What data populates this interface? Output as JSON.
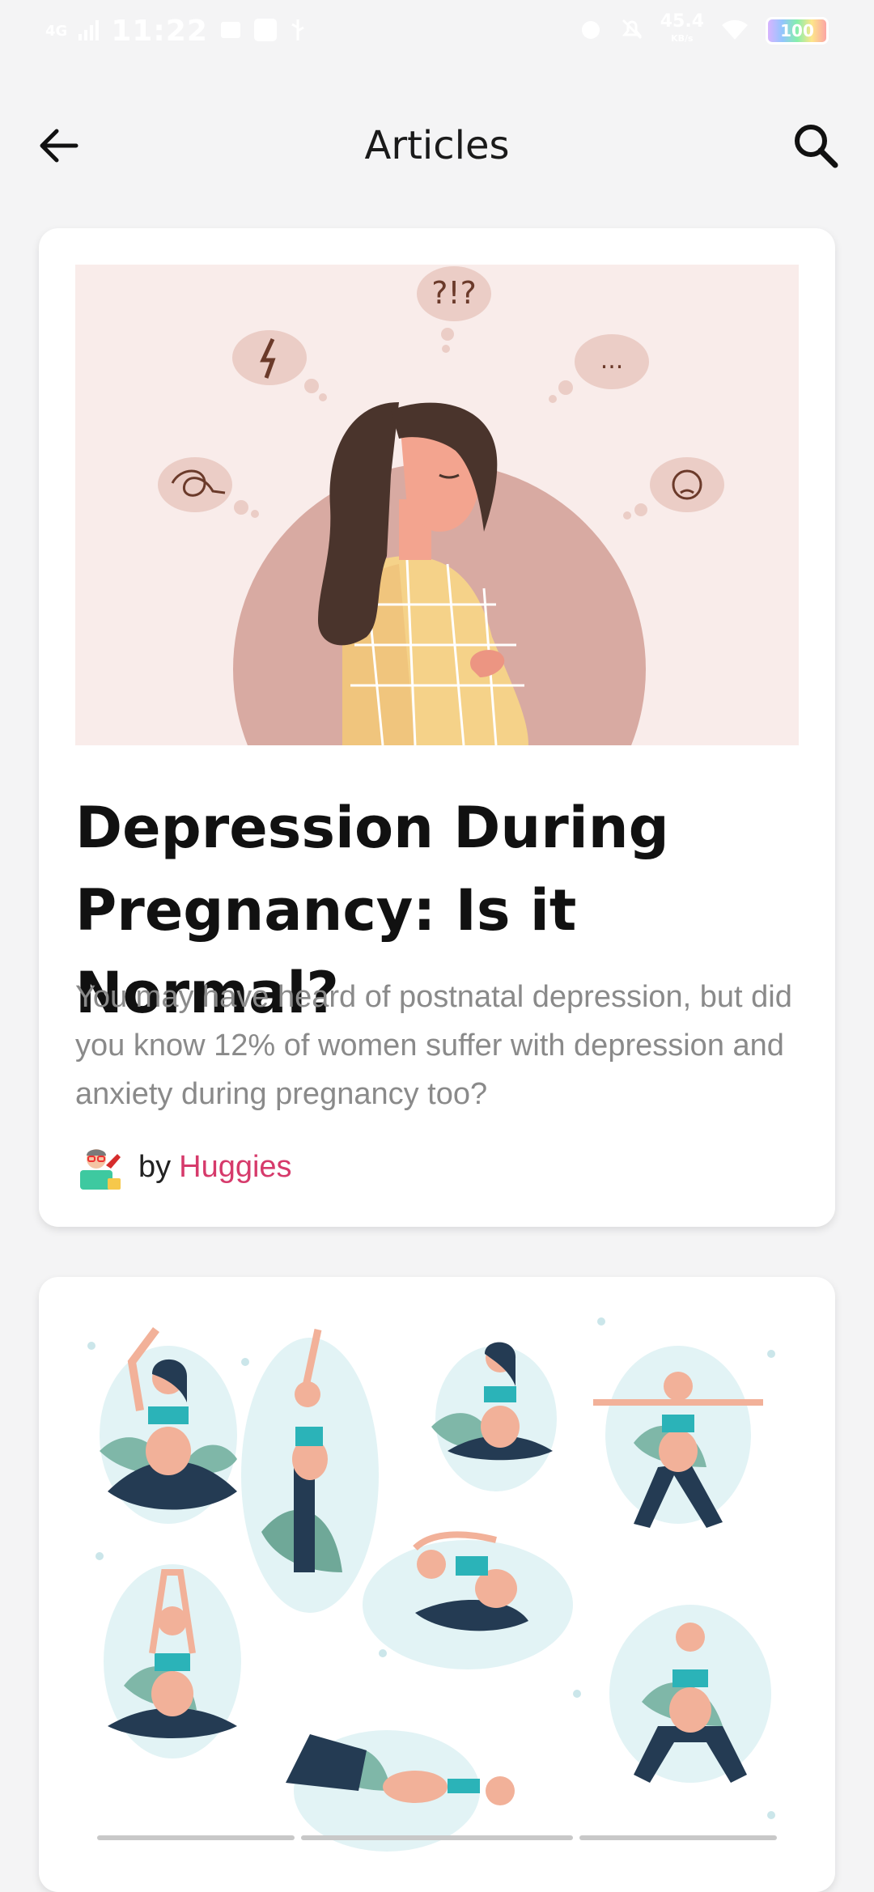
{
  "status_bar": {
    "network": "4G",
    "time": "11:22",
    "net_speed_value": "45.4",
    "net_speed_unit": "KB/s",
    "battery": "100"
  },
  "header": {
    "title": "Articles",
    "back_icon": "arrow-left-icon",
    "search_icon": "search-icon"
  },
  "articles": [
    {
      "title": "Depression During Pregnancy: Is it Normal?",
      "description": "You may have heard of postnatal depression, but did you know 12% of women suffer with depression and anxiety during pregnancy too?",
      "by_label": "by",
      "author": "Huggies",
      "thought_bubbles": [
        "?!?",
        "...",
        ""
      ]
    },
    {
      "title": "",
      "description": "",
      "by_label": "",
      "author": ""
    }
  ],
  "colors": {
    "background": "#f4f4f5",
    "card": "#ffffff",
    "author_accent": "#d63a6b",
    "description_gray": "#8a8a8a"
  }
}
